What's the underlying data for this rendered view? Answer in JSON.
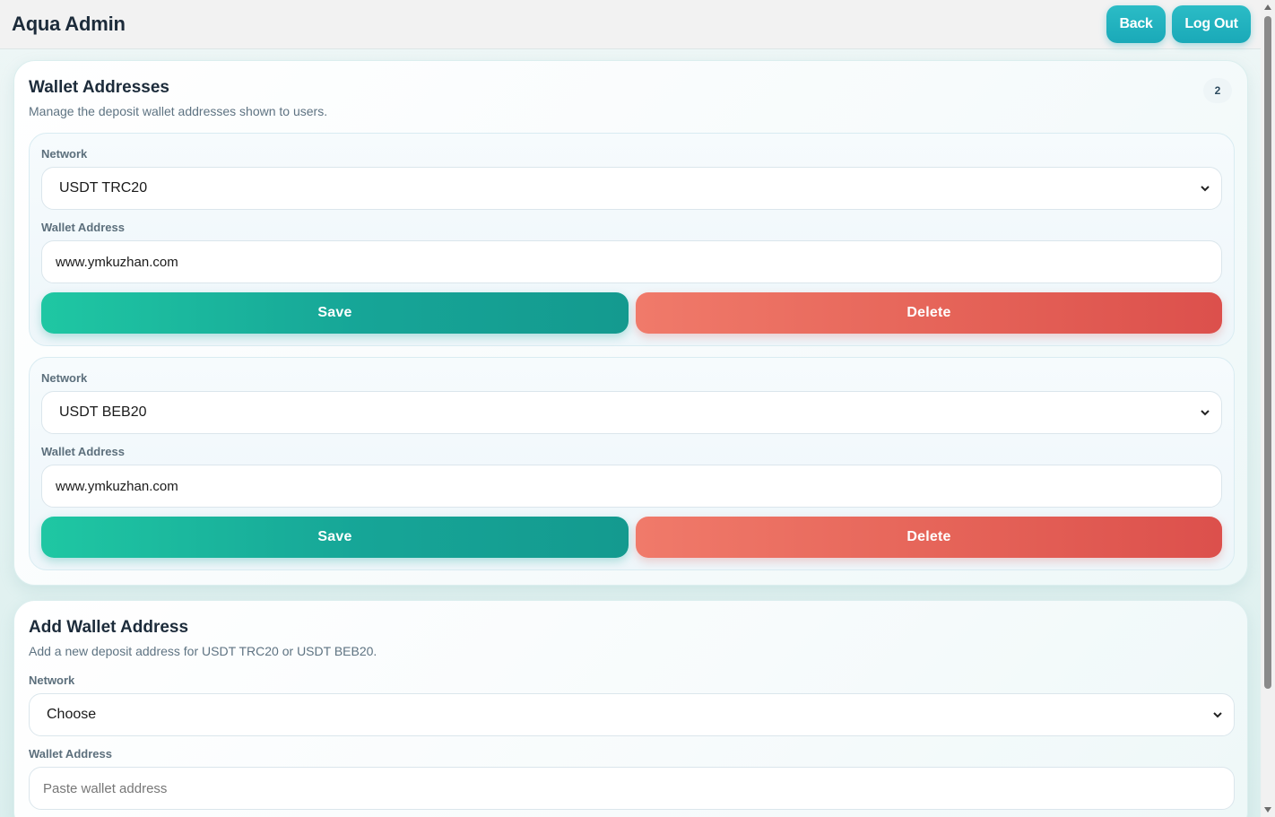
{
  "header": {
    "brand": "Aqua Admin",
    "back_label": "Back",
    "logout_label": "Log Out"
  },
  "wallets_panel": {
    "title": "Wallet Addresses",
    "subtitle": "Manage the deposit wallet addresses shown to users.",
    "count": "2",
    "cards": [
      {
        "network_label": "Network",
        "network_value": "USDT TRC20",
        "address_label": "Wallet Address",
        "address_value": "www.ymkuzhan.com",
        "save_label": "Save",
        "delete_label": "Delete"
      },
      {
        "network_label": "Network",
        "network_value": "USDT BEB20",
        "address_label": "Wallet Address",
        "address_value": "www.ymkuzhan.com",
        "save_label": "Save",
        "delete_label": "Delete"
      }
    ]
  },
  "add_panel": {
    "title": "Add Wallet Address",
    "subtitle": "Add a new deposit address for USDT TRC20 or USDT BEB20.",
    "network_label": "Network",
    "network_value": "Choose",
    "address_label": "Wallet Address",
    "address_placeholder": "Paste wallet address"
  },
  "colors": {
    "accent": "#1aa9b8",
    "save": "#16a597",
    "delete": "#e56358",
    "text_dark": "#1c2b3a"
  },
  "icons": {
    "select_arrow": "chevron-down-icon"
  }
}
